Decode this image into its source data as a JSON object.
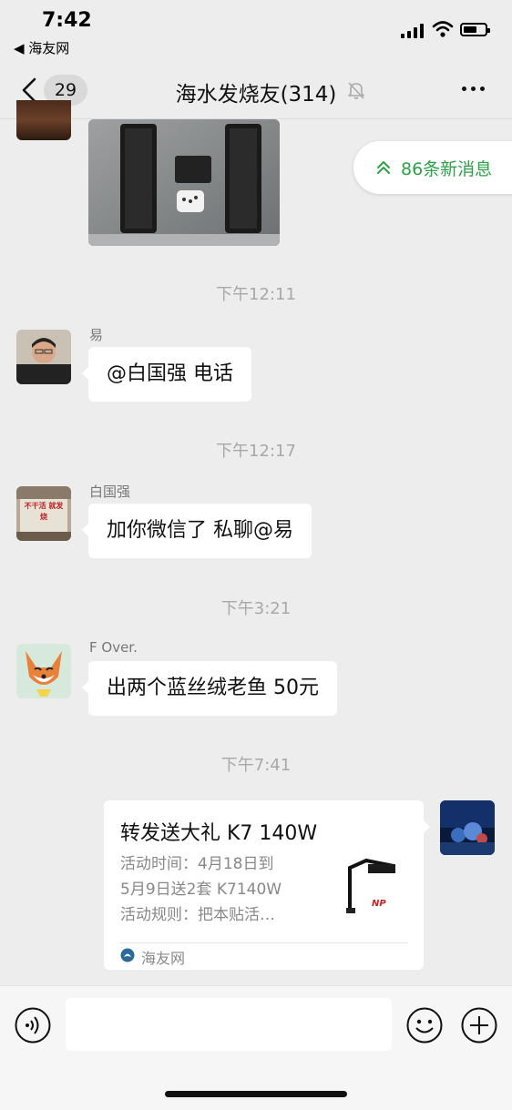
{
  "status_bar": {
    "time": "7:42",
    "back_app": "◀ 海友网"
  },
  "header": {
    "unread_count": "29",
    "title": "海水发烧友(314)",
    "muted": true
  },
  "new_messages_label": "86条新消息",
  "messages": [
    {
      "type": "timestamp",
      "text": "下午12:11"
    },
    {
      "type": "text",
      "sender": "易",
      "text": "@白国强 电话"
    },
    {
      "type": "timestamp",
      "text": "下午12:17"
    },
    {
      "type": "text",
      "sender": "白国强",
      "text": "加你微信了 私聊@易",
      "avatar_sign_text": "不干活 就发烧"
    },
    {
      "type": "timestamp",
      "text": "下午3:21"
    },
    {
      "type": "text",
      "sender": "F Over.",
      "text": "出两个蓝丝绒老鱼 50元"
    },
    {
      "type": "timestamp",
      "text": "下午7:41"
    }
  ],
  "link_card": {
    "title": "转发送大礼 K7 140W",
    "desc_lines": [
      "活动时间：4月18日到",
      "5月9日送2套 K7140W",
      "活动规则：把本贴活…"
    ],
    "thumb_brand": "NP",
    "source": "海友网"
  },
  "input": {
    "placeholder": ""
  },
  "colors": {
    "background": "#ededed",
    "bubble": "#ffffff",
    "accent_green": "#2ba245",
    "timestamp": "#a8a8a8"
  },
  "icons": [
    "back-chevron-icon",
    "mute-bell-icon",
    "more-dots-icon",
    "double-up-arrow-icon",
    "voice-icon",
    "emoji-icon",
    "plus-icon"
  ]
}
